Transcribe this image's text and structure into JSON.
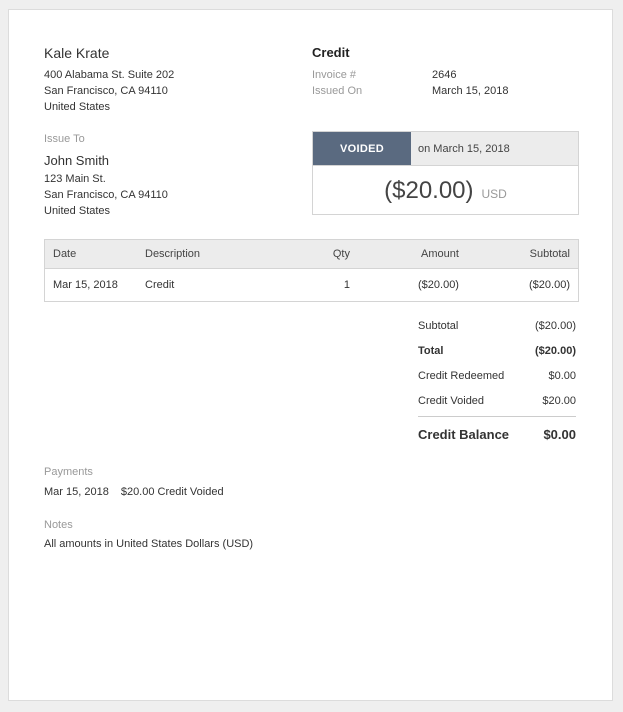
{
  "company": {
    "name": "Kale Krate",
    "address": [
      "400 Alabama St. Suite 202",
      "San Francisco, CA 94110",
      "United States"
    ]
  },
  "document": {
    "type": "Credit",
    "invoice_label": "Invoice #",
    "invoice_value": "2646",
    "issued_label": "Issued On",
    "issued_value": "March 15, 2018"
  },
  "issue_to": {
    "label": "Issue To",
    "name": "John Smith",
    "address": [
      "123 Main St.",
      "San Francisco, CA 94110",
      "United States"
    ]
  },
  "status": {
    "badge": "VOIDED",
    "date_text": "on March 15, 2018",
    "amount": "($20.00)",
    "currency": "USD"
  },
  "items_table": {
    "headers": [
      "Date",
      "Description",
      "Qty",
      "Amount",
      "Subtotal"
    ],
    "rows": [
      [
        "Mar 15, 2018",
        "Credit",
        "1",
        "($20.00)",
        "($20.00)"
      ]
    ]
  },
  "totals": {
    "subtotal_label": "Subtotal",
    "subtotal_value": "($20.00)",
    "total_label": "Total",
    "total_value": "($20.00)",
    "redeemed_label": "Credit Redeemed",
    "redeemed_value": "$0.00",
    "voided_label": "Credit Voided",
    "voided_value": "$20.00",
    "balance_label": "Credit Balance",
    "balance_value": "$0.00"
  },
  "payments": {
    "label": "Payments",
    "date": "Mar 15, 2018",
    "text": "$20.00 Credit Voided"
  },
  "notes": {
    "label": "Notes",
    "text": "All amounts in United States Dollars (USD)"
  }
}
